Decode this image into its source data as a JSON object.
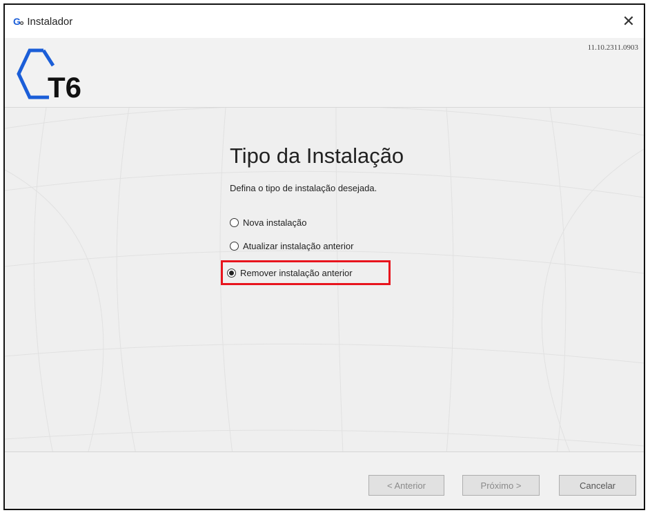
{
  "window": {
    "title": "Instalador",
    "close_glyph": "✕",
    "icon_name": "go-app-icon",
    "icon_text": "G",
    "icon_sub": "o"
  },
  "header": {
    "logo_text": "T6",
    "version": "11.10.2311.0903",
    "logo_color": "#1b5ed8"
  },
  "main": {
    "title": "Tipo da Instalação",
    "subtitle": "Defina o tipo de instalação desejada.",
    "options": [
      {
        "label": "Nova instalação",
        "checked": false
      },
      {
        "label": "Atualizar instalação anterior",
        "checked": false
      },
      {
        "label": "Remover instalação anterior",
        "checked": true
      }
    ]
  },
  "footer": {
    "back_label": "< Anterior",
    "next_label": "Próximo >",
    "cancel_label": "Cancelar"
  },
  "colors": {
    "highlight": "#e8141d",
    "background": "#f1f1f1"
  }
}
